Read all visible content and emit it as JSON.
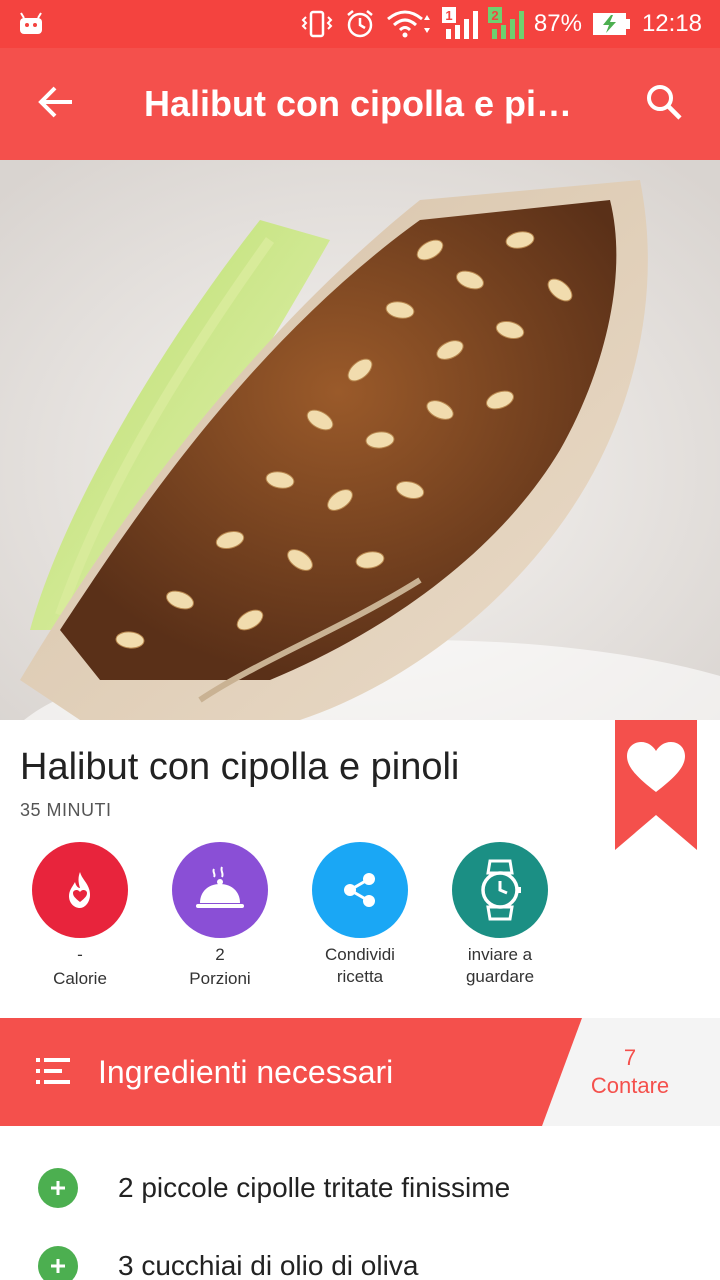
{
  "status_bar": {
    "battery": "87%",
    "time": "12:18",
    "icons": [
      "android-icon",
      "vibrate-icon",
      "alarm-icon",
      "wifi-icon",
      "signal-1-icon",
      "signal-2-icon",
      "battery-charging-icon"
    ],
    "sim_1": "1",
    "sim_2": "2"
  },
  "toolbar": {
    "title": "Halibut con cipolla e pi…",
    "back_icon": "arrow-left-icon",
    "search_icon": "search-icon"
  },
  "recipe": {
    "title": "Halibut con cipolla e pinoli",
    "time": "35 MINUTI",
    "favorite_icon": "heart-icon"
  },
  "actions": [
    {
      "value": "-",
      "label": "Calorie",
      "icon": "flame-icon",
      "color": "#e8243c"
    },
    {
      "value": "2",
      "label": "Porzioni",
      "icon": "cloche-icon",
      "color": "#8a4fd6"
    },
    {
      "value": "Condividi",
      "label": "ricetta",
      "icon": "share-icon",
      "color": "#1aa7f5"
    },
    {
      "value": "inviare a",
      "label": "guardare",
      "icon": "watch-icon",
      "color": "#1b8f84"
    }
  ],
  "ingredients": {
    "header": "Ingredienti necessari",
    "count": "7",
    "count_label": "Contare",
    "items": [
      "2 piccole cipolle tritate finissime",
      "3 cucchiai di olio di oliva"
    ]
  },
  "colors": {
    "primary": "#f4504c",
    "status_bar": "#f4433f",
    "add_green": "#4caf50"
  }
}
